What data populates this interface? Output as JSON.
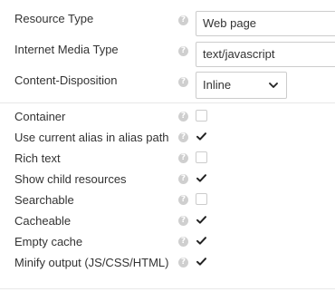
{
  "form": {
    "resource_type": {
      "label": "Resource Type",
      "value": "Web page"
    },
    "media_type": {
      "label": "Internet Media Type",
      "value": "text/javascript"
    },
    "content_disposition": {
      "label": "Content-Disposition",
      "value": "Inline"
    },
    "help_glyph": "?",
    "checkboxes": [
      {
        "label": "Container",
        "checked": false
      },
      {
        "label": "Use current alias in alias path",
        "checked": true
      },
      {
        "label": "Rich text",
        "checked": false
      },
      {
        "label": "Show child resources",
        "checked": true
      },
      {
        "label": "Searchable",
        "checked": false
      },
      {
        "label": "Cacheable",
        "checked": true
      },
      {
        "label": "Empty cache",
        "checked": true
      },
      {
        "label": "Minify output (JS/CSS/HTML)",
        "checked": true
      }
    ]
  },
  "icons": {
    "help": "help-circle-icon",
    "check": "checkmark-icon",
    "dropdown": "chevron-down-icon"
  }
}
